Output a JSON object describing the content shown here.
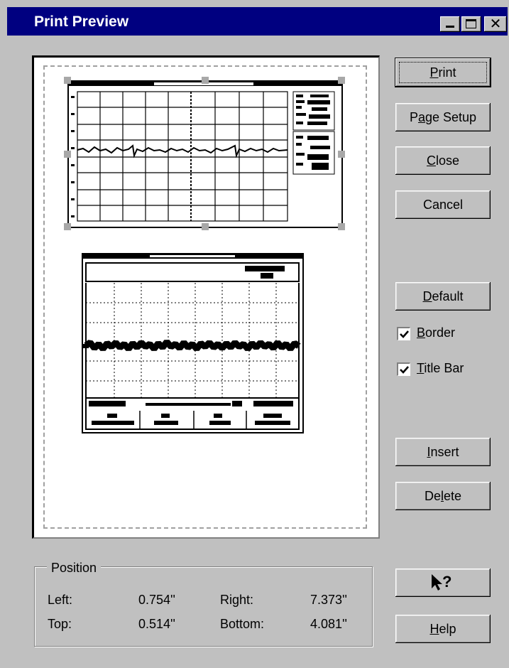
{
  "window": {
    "title": "Print Preview",
    "controls": [
      "minimize",
      "maximize",
      "close"
    ],
    "close_glyph": "✕",
    "icons": {
      "minimize": "minimize-icon",
      "maximize": "maximize-icon",
      "close": "close-icon",
      "help_pointer": "arrow-question-icon"
    }
  },
  "buttons": {
    "print": {
      "pre": "",
      "key": "P",
      "post": "rint"
    },
    "page_setup": {
      "pre": "P",
      "key": "a",
      "post": "ge Setup"
    },
    "close": {
      "pre": "",
      "key": "C",
      "post": "lose"
    },
    "cancel": {
      "pre": "Cancel",
      "key": "",
      "post": ""
    },
    "default": {
      "pre": "",
      "key": "D",
      "post": "efault"
    },
    "insert": {
      "pre": "",
      "key": "I",
      "post": "nsert"
    },
    "delete": {
      "pre": "De",
      "key": "l",
      "post": "ete"
    },
    "help": {
      "pre": "",
      "key": "H",
      "post": "elp"
    },
    "help_pointer_glyph": "?"
  },
  "checkboxes": {
    "border": {
      "pre": "",
      "key": "B",
      "post": "order",
      "checked": true
    },
    "title_bar": {
      "pre": "",
      "key": "T",
      "post": "itle Bar",
      "checked": true
    }
  },
  "position": {
    "group_label": "Position",
    "left_label": "Left:",
    "left_value": "0.754''",
    "right_label": "Right:",
    "right_value": "7.373''",
    "top_label": "Top:",
    "top_value": "0.514''",
    "bottom_label": "Bottom:",
    "bottom_value": "4.081''"
  },
  "colors": {
    "titlebar": "#000080",
    "face": "#c0c0c0",
    "trace": "#000000"
  }
}
